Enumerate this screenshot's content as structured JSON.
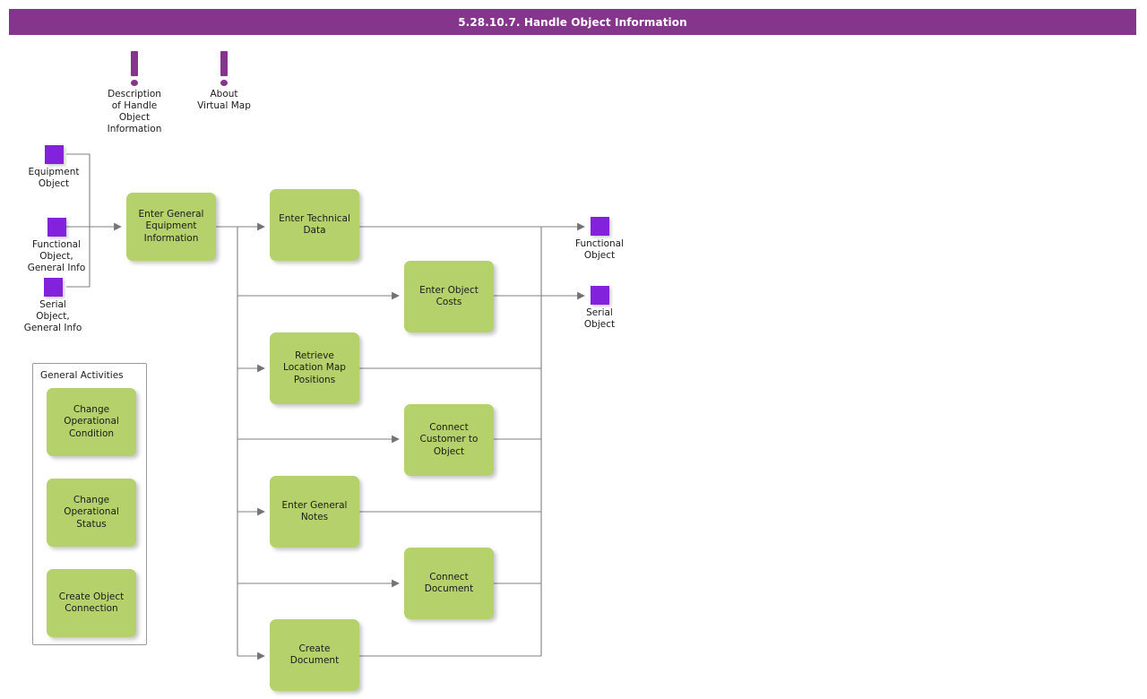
{
  "header": {
    "title": "5.28.10.7. Handle Object Information",
    "bar_color": "#85368c"
  },
  "palette": {
    "activity_green": "#b5d16c",
    "object_purple": "#8222dd",
    "note_purple": "#85368c",
    "wire_gray": "#808080",
    "text_dark": "#1b1b1b"
  },
  "notes": [
    {
      "label": "Description\nof Handle\nObject\nInformation",
      "icon": "exclamation-icon"
    },
    {
      "label": "About\nVirtual Map",
      "icon": "exclamation-icon"
    }
  ],
  "input_objects": [
    {
      "label": "Equipment\nObject",
      "icon": "object-square-icon"
    },
    {
      "label": "Functional\nObject,\nGeneral Info",
      "icon": "object-square-icon"
    },
    {
      "label": "Serial\nObject,\nGeneral Info",
      "icon": "object-square-icon"
    }
  ],
  "output_objects": [
    {
      "label": "Functional\nObject",
      "icon": "object-square-icon"
    },
    {
      "label": "Serial\nObject",
      "icon": "object-square-icon"
    }
  ],
  "main_activity": {
    "label": "Enter General\nEquipment\nInformation"
  },
  "activities": [
    {
      "label": "Enter Technical\nData"
    },
    {
      "label": "Enter Object\nCosts"
    },
    {
      "label": "Retrieve\nLocation Map\nPositions"
    },
    {
      "label": "Connect\nCustomer to\nObject"
    },
    {
      "label": "Enter General\nNotes"
    },
    {
      "label": "Connect\nDocument"
    },
    {
      "label": "Create\nDocument"
    }
  ],
  "general_activities_group": {
    "title": "General Activities",
    "items": [
      {
        "label": "Change\nOperational\nCondition"
      },
      {
        "label": "Change\nOperational\nStatus"
      },
      {
        "label": "Create Object\nConnection"
      }
    ]
  }
}
